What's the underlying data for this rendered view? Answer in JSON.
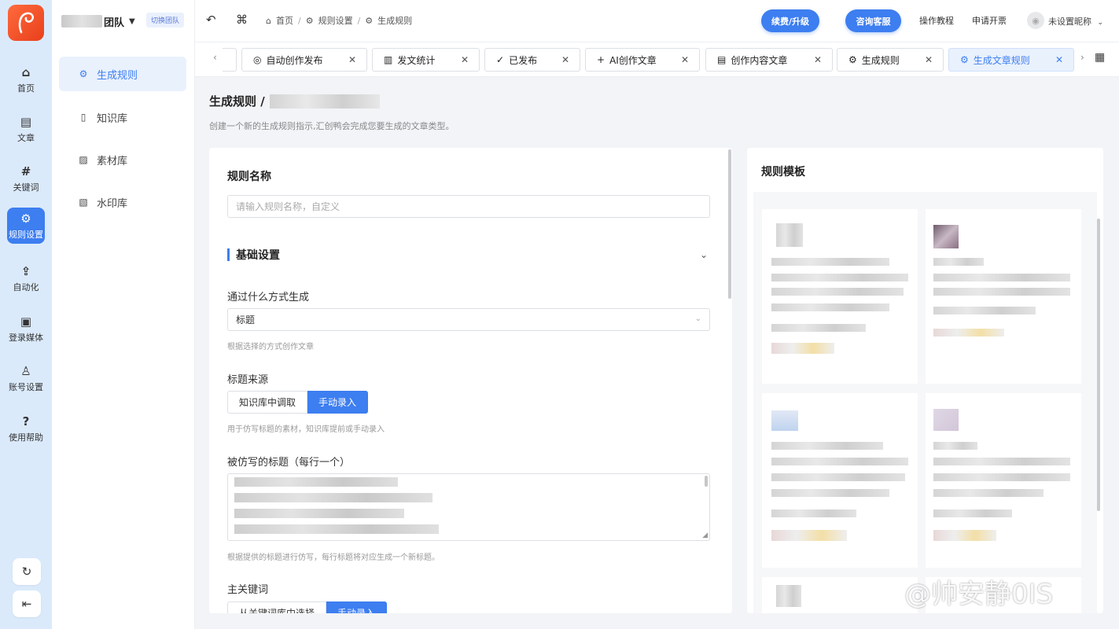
{
  "rail": {
    "items": [
      {
        "label": "首页",
        "icon": "home-icon"
      },
      {
        "label": "文章",
        "icon": "document-icon"
      },
      {
        "label": "关键词",
        "icon": "hash-icon"
      },
      {
        "label": "规则设置",
        "icon": "gear-icon",
        "active": true
      },
      {
        "label": "自动化",
        "icon": "upload-icon"
      },
      {
        "label": "登录媒体",
        "icon": "media-icon"
      },
      {
        "label": "账号设置",
        "icon": "user-settings-icon"
      },
      {
        "label": "使用帮助",
        "icon": "help-icon"
      }
    ],
    "bottom": [
      {
        "icon": "refresh-icon"
      },
      {
        "icon": "collapse-icon"
      }
    ]
  },
  "sidebar": {
    "team_name": "团队",
    "switch_team": "切换团队",
    "items": [
      {
        "label": "生成规则",
        "icon": "gear-icon",
        "active": true
      },
      {
        "label": "知识库",
        "icon": "book-icon"
      },
      {
        "label": "素材库",
        "icon": "image-icon"
      },
      {
        "label": "水印库",
        "icon": "watermark-icon"
      }
    ]
  },
  "topbar": {
    "breadcrumb": [
      "首页",
      "规则设置",
      "生成规则"
    ],
    "renew_button": "续费/升级",
    "support_button": "咨询客服",
    "tutorial_link": "操作教程",
    "invoice_link": "申请开票",
    "username": "未设置昵称"
  },
  "tabs": [
    {
      "label": "自动创作发布",
      "icon": "camera-icon"
    },
    {
      "label": "发文统计",
      "icon": "chart-icon"
    },
    {
      "label": "已发布",
      "icon": "check-circle-icon"
    },
    {
      "label": "AI创作文章",
      "icon": "plus-icon"
    },
    {
      "label": "创作内容文章",
      "icon": "file-icon"
    },
    {
      "label": "生成规则",
      "icon": "gear-icon"
    },
    {
      "label": "生成文章规则",
      "icon": "gear-icon",
      "active": true
    }
  ],
  "page": {
    "title": "生成规则 /",
    "description": "创建一个新的生成规则指示,汇创鸭会完成您要生成的文章类型。"
  },
  "form": {
    "rule_name_label": "规则名称",
    "rule_name_placeholder": "请输入规则名称，自定义",
    "basic_section": "基础设置",
    "method_label": "通过什么方式生成",
    "method_value": "标题",
    "method_hint": "根据选择的方式创作文章",
    "title_source_label": "标题来源",
    "title_source_options": [
      "知识库中调取",
      "手动录入"
    ],
    "title_source_selected": "手动录入",
    "title_source_hint": "用于仿写标题的素材，知识库提前或手动录入",
    "imitated_titles_label": "被仿写的标题（每行一个）",
    "imitated_titles_hint": "根据提供的标题进行仿写，每行标题将对应生成一个新标题。",
    "main_keyword_label": "主关键词",
    "main_keyword_options": [
      "从关键词库中选择",
      "手动录入"
    ]
  },
  "templates": {
    "title": "规则模板"
  },
  "watermark": "@帅安静0IS",
  "colors": {
    "accent": "#3d7ef0",
    "rail_bg": "#dbeafb",
    "logo": "#ef4b22"
  }
}
